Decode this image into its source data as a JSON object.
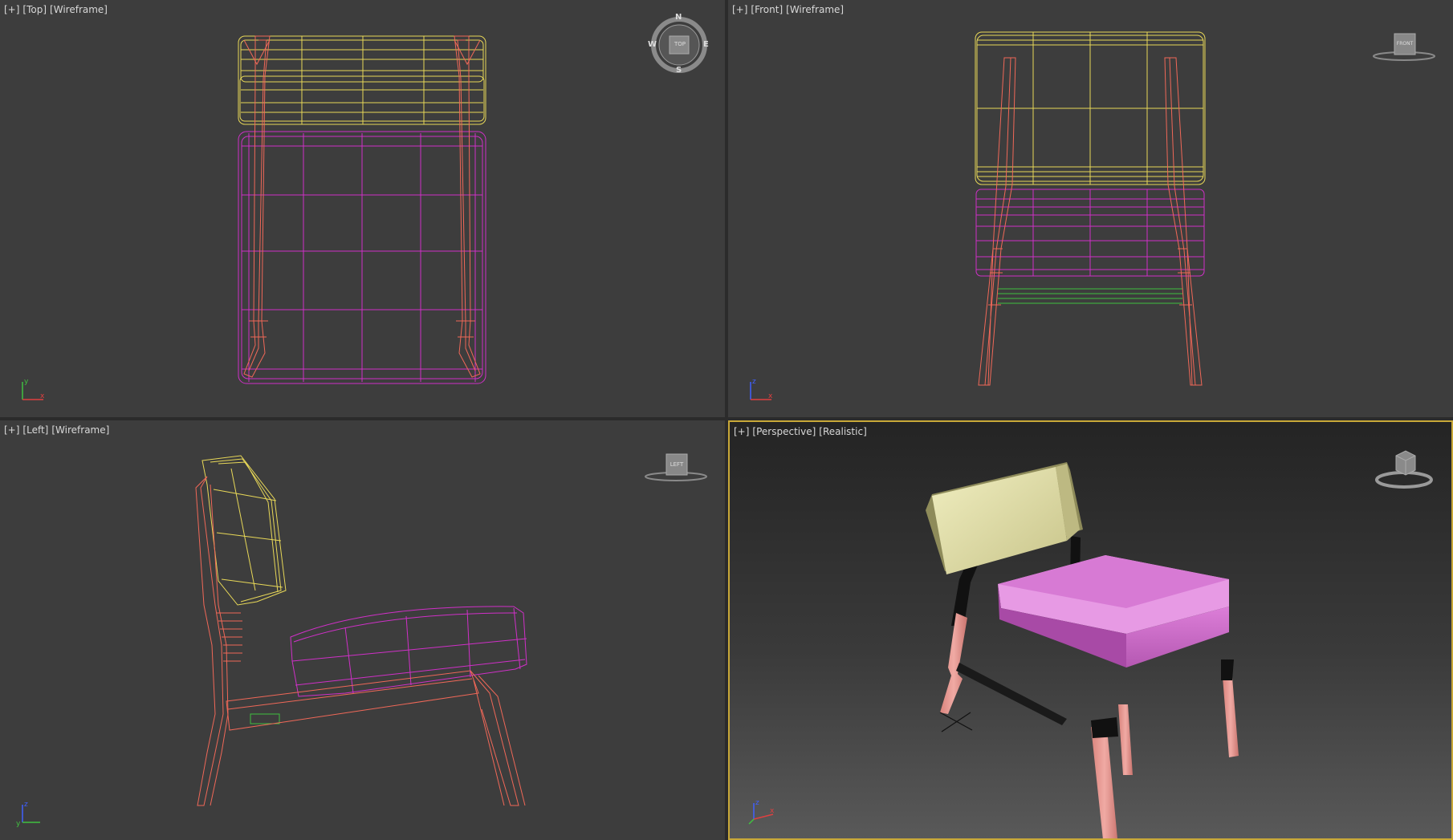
{
  "viewports": {
    "top": {
      "menu": "[+]",
      "view": "[Top]",
      "shading": "[Wireframe]",
      "cube_label": "TOP",
      "compass": {
        "n": "N",
        "s": "S",
        "e": "E",
        "w": "W"
      }
    },
    "front": {
      "menu": "[+]",
      "view": "[Front]",
      "shading": "[Wireframe]",
      "cube_label": "FRONT"
    },
    "left": {
      "menu": "[+]",
      "view": "[Left]",
      "shading": "[Wireframe]",
      "cube_label": "LEFT"
    },
    "perspective": {
      "menu": "[+]",
      "view": "[Perspective]",
      "shading": "[Realistic]"
    }
  },
  "axes": {
    "x": "x",
    "y": "y",
    "z": "z"
  },
  "colors": {
    "viewport_bg": "#3d3d3d",
    "active_border": "#c8a838",
    "backrest_wire": "#e8d858",
    "seat_wire": "#d030c8",
    "frame_wire": "#f06858",
    "backrest_solid": "#e8e4a8",
    "seat_solid": "#c86ac4",
    "frame_solid": "#e3958e"
  }
}
